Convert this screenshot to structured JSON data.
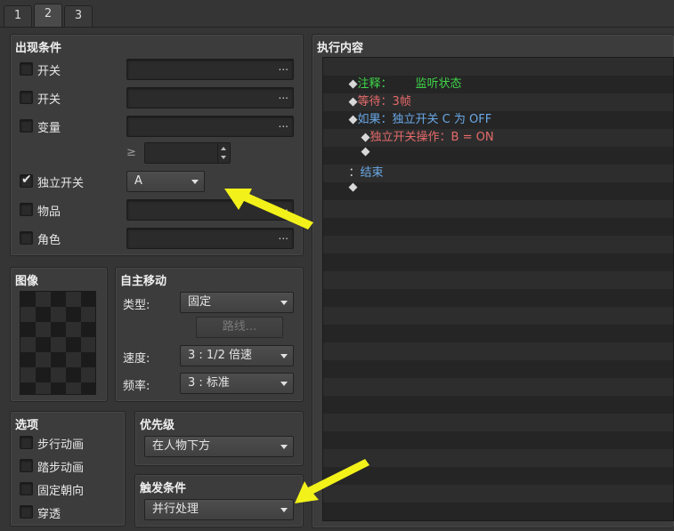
{
  "tabs": [
    "1",
    "2",
    "3"
  ],
  "conditions": {
    "title": "出现条件",
    "switch1_label": "开关",
    "switch2_label": "开关",
    "variable_label": "变量",
    "ge_symbol": "≥",
    "self_switch_label": "独立开关",
    "self_switch_value": "A",
    "item_label": "物品",
    "actor_label": "角色",
    "ellipsis": "..."
  },
  "image": {
    "title": "图像"
  },
  "autonomous": {
    "title": "自主移动",
    "type_label": "类型:",
    "type_value": "固定",
    "route_button": "路线...",
    "speed_label": "速度:",
    "speed_value": "3 : 1/2 倍速",
    "freq_label": "频率:",
    "freq_value": "3 : 标准"
  },
  "options": {
    "title": "选项",
    "walking": "步行动画",
    "stepping": "踏步动画",
    "direction_fix": "固定朝向",
    "through": "穿透"
  },
  "priority": {
    "title": "优先级",
    "value": "在人物下方"
  },
  "trigger": {
    "title": "触发条件",
    "value": "并行处理"
  },
  "contents": {
    "title": "执行内容",
    "lines": [
      {
        "diamond": "◆",
        "cmd": "注释：",
        "arg": "监听状态"
      },
      {
        "diamond": "◆",
        "cmd": "等待：",
        "arg": "3帧"
      },
      {
        "diamond": "◆",
        "cmd": "如果：",
        "arg": "独立开关 C 为 OFF"
      },
      {
        "diamond": "◆",
        "cmd": "独立开关操作：",
        "arg": "B = ON"
      },
      {
        "diamond": "◆"
      },
      {
        "prefix": "：",
        "cmd": "结束"
      },
      {
        "diamond": "◆"
      }
    ]
  },
  "colors": {
    "comment": "#3fd64a",
    "wait": "#e66a6a",
    "flow": "#6aa8e6",
    "selfswitch": "#e66a6a",
    "arrow": "#f2f21a"
  }
}
